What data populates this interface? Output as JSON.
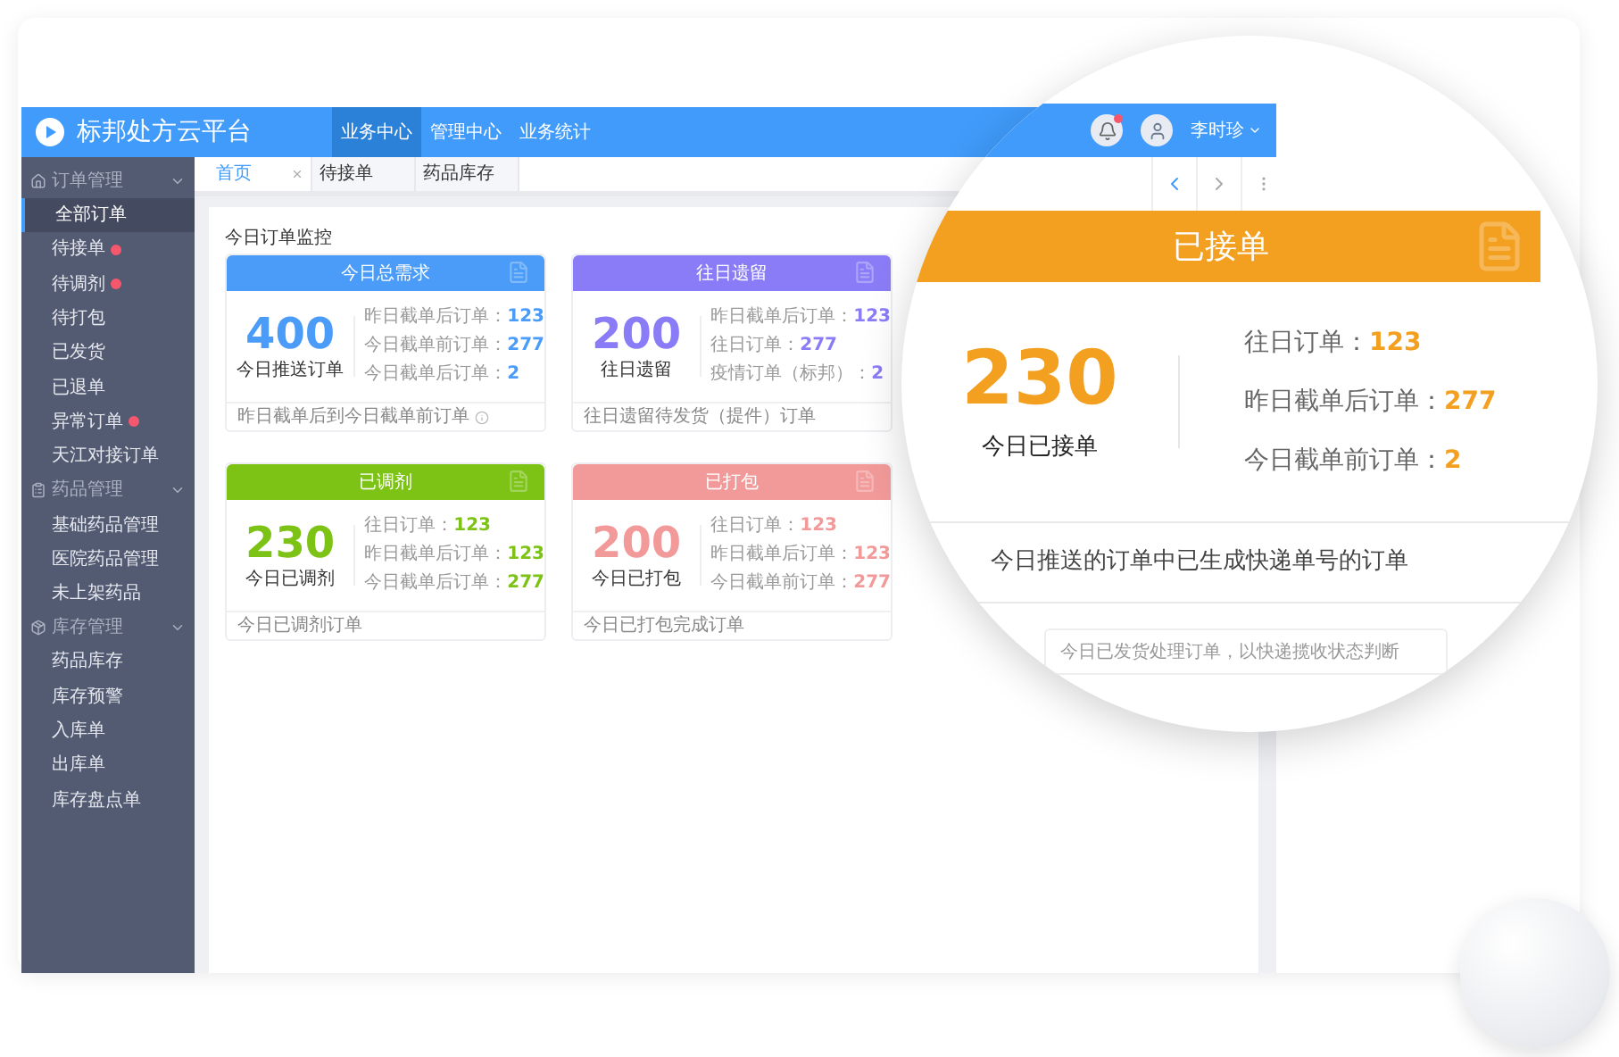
{
  "header": {
    "logo_text": "标邦处方云平台",
    "nav": [
      {
        "label": "业务中心",
        "selected": true
      },
      {
        "label": "管理中心",
        "selected": false
      },
      {
        "label": "业务统计",
        "selected": false
      }
    ]
  },
  "sidebar": {
    "groups": [
      {
        "kind": "orders",
        "label": "订单管理",
        "expanded": true,
        "children": [
          {
            "label": "全部订单",
            "selected": true,
            "badge": false
          },
          {
            "label": "待接单",
            "selected": false,
            "badge": true
          },
          {
            "label": "待调剂",
            "selected": false,
            "badge": true
          },
          {
            "label": "待打包",
            "selected": false,
            "badge": false
          },
          {
            "label": "已发货",
            "selected": false,
            "badge": false
          },
          {
            "label": "已退单",
            "selected": false,
            "badge": false
          },
          {
            "label": "异常订单",
            "selected": false,
            "badge": true
          },
          {
            "label": "天江对接订单",
            "selected": false,
            "badge": false
          }
        ]
      },
      {
        "kind": "drugs",
        "label": "药品管理",
        "expanded": true,
        "children": [
          {
            "label": "基础药品管理",
            "selected": false,
            "badge": false
          },
          {
            "label": "医院药品管理",
            "selected": false,
            "badge": false
          },
          {
            "label": "未上架药品",
            "selected": false,
            "badge": false
          }
        ]
      },
      {
        "kind": "stock",
        "label": "库存管理",
        "expanded": true,
        "children": [
          {
            "label": "药品库存",
            "selected": false,
            "badge": false
          },
          {
            "label": "库存预警",
            "selected": false,
            "badge": false
          },
          {
            "label": "入库单",
            "selected": false,
            "badge": false
          },
          {
            "label": "出库单",
            "selected": false,
            "badge": false
          },
          {
            "label": "库存盘点单",
            "selected": false,
            "badge": false
          }
        ]
      }
    ]
  },
  "tabs": [
    {
      "label": "首页",
      "selected": true,
      "closable": true
    },
    {
      "label": "待接单",
      "selected": false,
      "closable": false
    },
    {
      "label": "药品库存",
      "selected": false,
      "closable": false
    }
  ],
  "panel": {
    "title": "今日订单监控",
    "cards": [
      {
        "title": "今日总需求",
        "color": "#4a9cf8",
        "value": "400",
        "caption": "今日推送订单",
        "stats": [
          {
            "label": "昨日截单后订单：",
            "value": "123"
          },
          {
            "label": "今日截单前订单：",
            "value": "277"
          },
          {
            "label": "今日截单后订单：",
            "value": "2"
          }
        ],
        "footer": "昨日截单后到今日截单前订单",
        "info": true
      },
      {
        "title": "往日遗留",
        "color": "#8a7cf6",
        "value": "200",
        "caption": "往日遗留",
        "stats": [
          {
            "label": "昨日截单后订单：",
            "value": "123"
          },
          {
            "label": "往日订单：",
            "value": "277"
          },
          {
            "label": "疫情订单（标邦）：",
            "value": "2"
          }
        ],
        "footer": "往日遗留待发货（提件）订单",
        "info": false
      },
      {
        "title": "已调剂",
        "color": "#7cc316",
        "value": "230",
        "caption": "今日已调剂",
        "stats": [
          {
            "label": "往日订单：",
            "value": "123"
          },
          {
            "label": "昨日截单后订单：",
            "value": "123"
          },
          {
            "label": "今日截单后订单：",
            "value": "277"
          }
        ],
        "footer": "今日已调剂订单",
        "info": false
      },
      {
        "title": "已打包",
        "color": "#f29a9a",
        "value": "200",
        "caption": "今日已打包",
        "stats": [
          {
            "label": "往日订单：",
            "value": "123"
          },
          {
            "label": "昨日截单后订单：",
            "value": "123"
          },
          {
            "label": "今日截单前订单：",
            "value": "277"
          }
        ],
        "footer": "今日已打包完成订单",
        "info": false
      }
    ]
  },
  "magnifier": {
    "user": {
      "name": "李时珍",
      "notification": true
    },
    "card": {
      "title": "已接单",
      "color": "#f3a020",
      "value": "230",
      "caption": "今日已接单",
      "stats": [
        {
          "label": "往日订单：",
          "value": "123"
        },
        {
          "label": "昨日截单后订单：",
          "value": "277"
        },
        {
          "label": "今日截单前订单：",
          "value": "2"
        }
      ],
      "footer": "今日推送的订单中已生成快递单号的订单"
    },
    "footer_box": "今日已发货处理订单，以快递揽收状态判断"
  }
}
